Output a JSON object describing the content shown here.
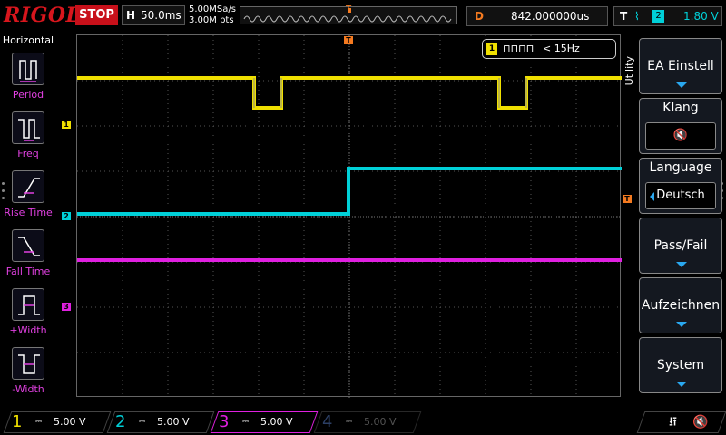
{
  "header": {
    "brand": "RIGOL",
    "run_state": "STOP",
    "timebase_label": "H",
    "timebase_value": "50.0ms",
    "sample_rate": "5.00MSa/s",
    "memory_depth": "3.00M pts",
    "delay_label": "D",
    "delay_value": "842.000000us",
    "trigger_label": "T",
    "trigger_slope": "⌇",
    "trigger_channel": "2",
    "trigger_level": "1.80 V",
    "trigger_marker": "T"
  },
  "left_panel": {
    "title": "Horizontal",
    "items": [
      {
        "label": "Period",
        "icon": "period-icon"
      },
      {
        "label": "Freq",
        "icon": "freq-icon"
      },
      {
        "label": "Rise Time",
        "icon": "rise-time-icon"
      },
      {
        "label": "Fall Time",
        "icon": "fall-time-icon"
      },
      {
        "label": "+Width",
        "icon": "positive-width-icon"
      },
      {
        "label": "-Width",
        "icon": "negative-width-icon"
      }
    ]
  },
  "scope": {
    "channel_markers": [
      "1",
      "2",
      "3"
    ],
    "trigger_level_marker": "T",
    "counter_channel": "1",
    "counter_waveform": "⊓⊓⊓⊓",
    "counter_value": "< 15Hz"
  },
  "right_menu": {
    "section_label": "Utility",
    "buttons": [
      {
        "label": "EA Einstell"
      },
      {
        "label": "Klang",
        "value": "🔇"
      },
      {
        "label": "Language",
        "value": "Deutsch"
      },
      {
        "label": "Pass/Fail"
      },
      {
        "label": "Aufzeichnen"
      },
      {
        "label": "System"
      }
    ]
  },
  "channels": [
    {
      "number": "1",
      "coupling": "⎓",
      "scale": "5.00 V",
      "color": "#f0e000"
    },
    {
      "number": "2",
      "coupling": "⎓",
      "scale": "5.00 V",
      "color": "#00d0d8"
    },
    {
      "number": "3",
      "coupling": "⎓",
      "scale": "5.00 V",
      "color": "#e020e0"
    },
    {
      "number": "4",
      "coupling": "⎓",
      "scale": "5.00 V",
      "color": "#4a6aa8"
    }
  ],
  "status": {
    "usb_icon": "usb-icon",
    "sound_icon": "speaker-mute-icon"
  },
  "colors": {
    "ch1": "#f0e000",
    "ch2": "#00d0d8",
    "ch3": "#e020e0",
    "ch4": "#4a6aa8",
    "trigger": "#f47a20",
    "accent": "#2aa8f0",
    "stop": "#c8101a"
  }
}
